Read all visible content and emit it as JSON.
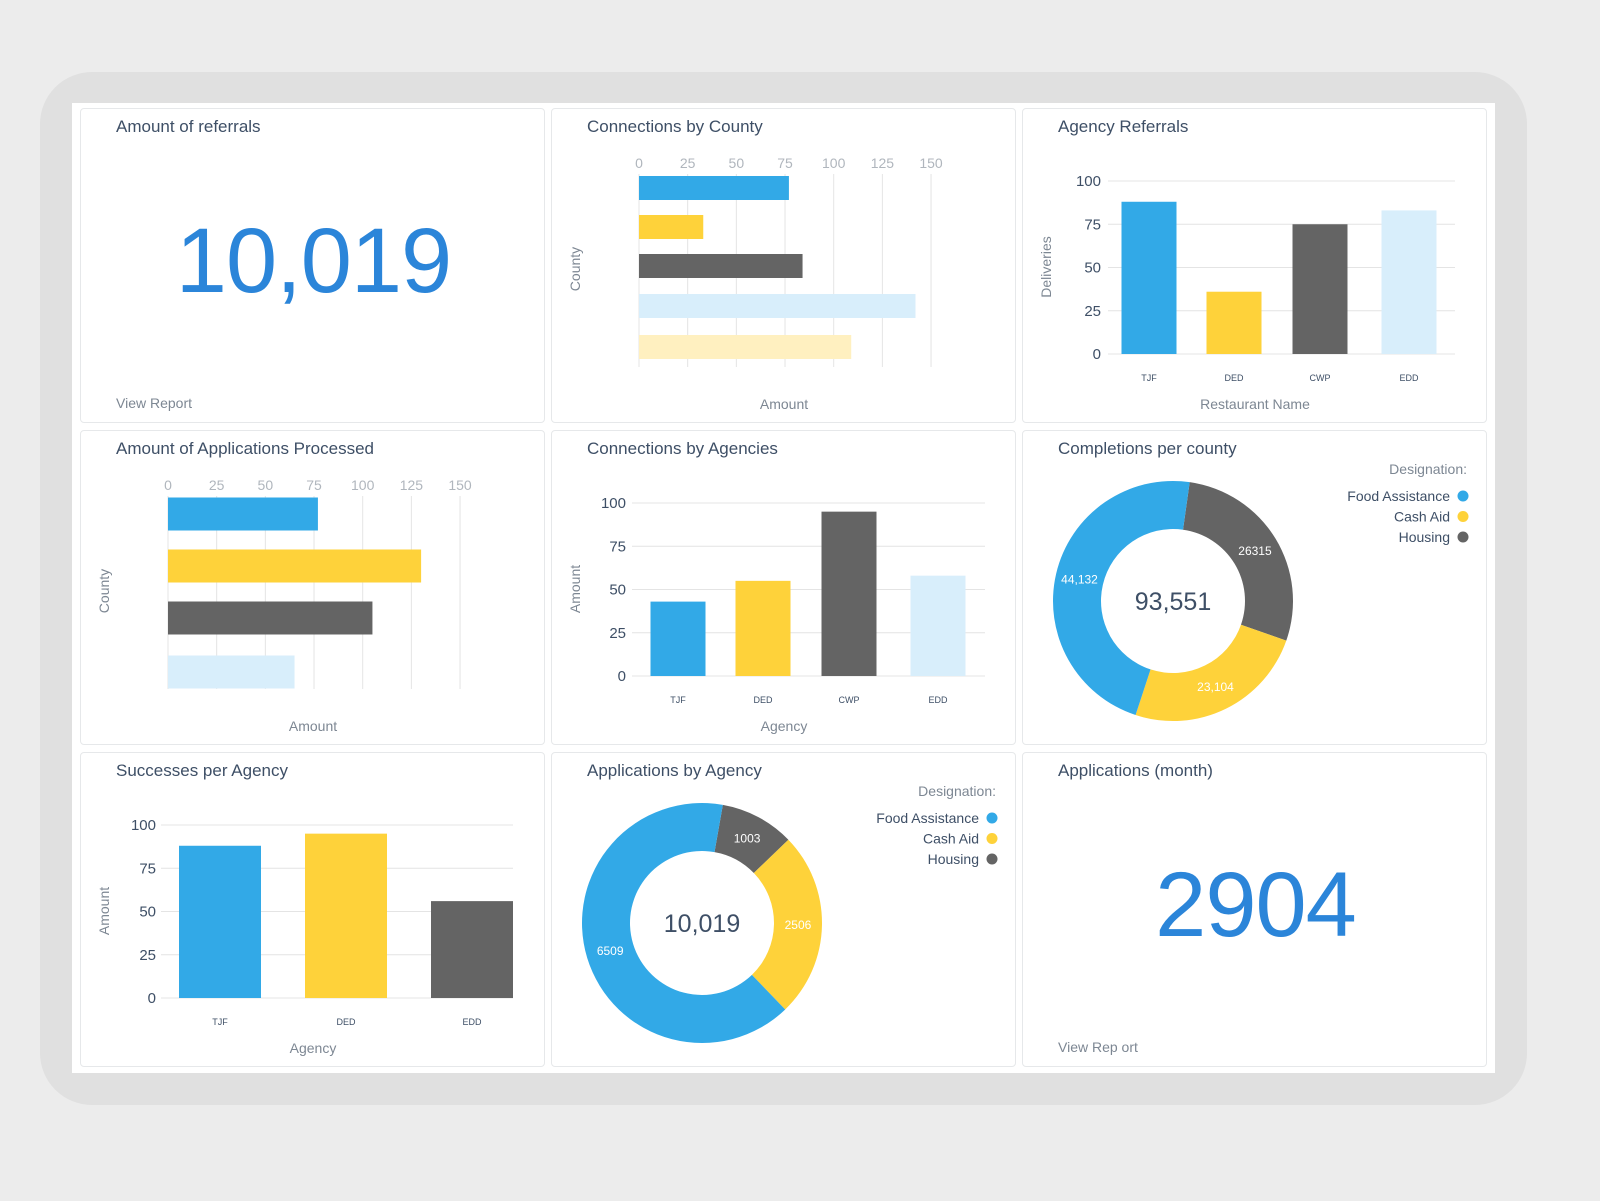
{
  "colors": {
    "blue": "#32a9e7",
    "yellow": "#fed23a",
    "gray": "#646464",
    "light_blue": "#d8eefb",
    "light_yellow": "#fff0c0",
    "kpi": "#2b85d9"
  },
  "cards": {
    "referrals": {
      "title": "Amount of referrals",
      "value": "10,019",
      "link": "View Report"
    },
    "applications_month": {
      "title": "Applications (month)",
      "value": "2904",
      "link": "View Rep ort"
    }
  },
  "chart_data": [
    {
      "id": "county",
      "title": "Connections by County",
      "type": "bar",
      "orientation": "horizontal",
      "xlabel": "Amount",
      "ylabel": "County",
      "xlim": [
        0,
        150
      ],
      "ticks": [
        0,
        25,
        50,
        75,
        100,
        125,
        150
      ],
      "grid": true,
      "values": [
        77,
        33,
        84,
        142,
        109
      ],
      "colors": [
        "#32a9e7",
        "#fed23a",
        "#646464",
        "#d8eefb",
        "#fff0c0"
      ]
    },
    {
      "id": "agencyref",
      "title": "Agency Referrals",
      "type": "bar",
      "orientation": "vertical",
      "xlabel": "Restaurant Name",
      "ylabel": "Deliveries",
      "ylim": [
        0,
        100
      ],
      "ticks": [
        0,
        25,
        50,
        75,
        100
      ],
      "grid": true,
      "categories": [
        "TJF",
        "DED",
        "CWP",
        "EDD"
      ],
      "values": [
        88,
        36,
        75,
        83
      ],
      "colors": [
        "#32a9e7",
        "#fed23a",
        "#646464",
        "#d8eefb"
      ]
    },
    {
      "id": "appsproc",
      "title": "Amount of Applications Processed",
      "type": "bar",
      "orientation": "horizontal",
      "xlabel": "Amount",
      "ylabel": "County",
      "xlim": [
        0,
        150
      ],
      "ticks": [
        0,
        25,
        50,
        75,
        100,
        125,
        150
      ],
      "grid": true,
      "values": [
        77,
        130,
        105,
        65
      ],
      "colors": [
        "#32a9e7",
        "#fed23a",
        "#646464",
        "#d8eefb"
      ]
    },
    {
      "id": "connagency",
      "title": "Connections by Agencies",
      "type": "bar",
      "orientation": "vertical",
      "xlabel": "Agency",
      "ylabel": "Amount",
      "ylim": [
        0,
        100
      ],
      "ticks": [
        0,
        25,
        50,
        75,
        100
      ],
      "grid": true,
      "categories": [
        "TJF",
        "DED",
        "CWP",
        "EDD"
      ],
      "values": [
        43,
        55,
        95,
        58
      ],
      "colors": [
        "#32a9e7",
        "#fed23a",
        "#646464",
        "#d8eefb"
      ]
    },
    {
      "id": "completions",
      "title": "Completions per county",
      "type": "pie",
      "donut": true,
      "center_label": "93,551",
      "legend_title": "Designation:",
      "legend": "top-right",
      "series": [
        {
          "name": "Food Assistance",
          "value": 44132,
          "label": "44,132",
          "color": "#32a9e7"
        },
        {
          "name": "Cash Aid",
          "value": 23104,
          "label": "23,104",
          "color": "#fed23a"
        },
        {
          "name": "Housing",
          "value": 26315,
          "label": "26315",
          "color": "#646464"
        }
      ]
    },
    {
      "id": "successes",
      "title": "Successes per Agency",
      "type": "bar",
      "orientation": "vertical",
      "xlabel": "Agency",
      "ylabel": "Amount",
      "ylim": [
        0,
        100
      ],
      "ticks": [
        0,
        25,
        50,
        75,
        100
      ],
      "grid": true,
      "categories": [
        "TJF",
        "DED",
        "EDD"
      ],
      "values": [
        88,
        95,
        56
      ],
      "colors": [
        "#32a9e7",
        "#fed23a",
        "#646464"
      ]
    },
    {
      "id": "appsagency",
      "title": "Applications by Agency",
      "type": "pie",
      "donut": true,
      "center_label": "10,019",
      "legend_title": "Designation:",
      "legend": "top-right",
      "series": [
        {
          "name": "Food Assistance",
          "value": 6509,
          "label": "6509",
          "color": "#32a9e7"
        },
        {
          "name": "Cash Aid",
          "value": 2506,
          "label": "2506",
          "color": "#fed23a"
        },
        {
          "name": "Housing",
          "value": 1003,
          "label": "1003",
          "color": "#646464"
        }
      ]
    }
  ]
}
